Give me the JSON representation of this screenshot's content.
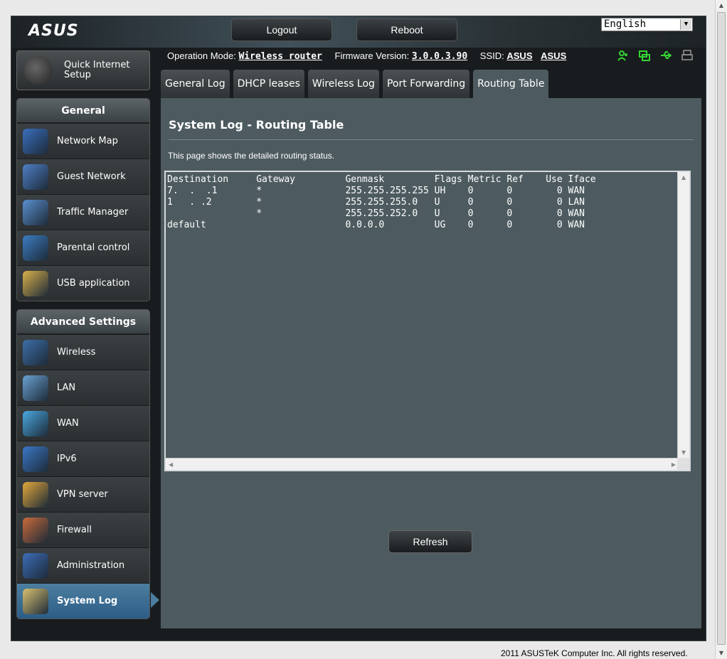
{
  "header": {
    "logo": "ASUS",
    "logout_label": "Logout",
    "reboot_label": "Reboot",
    "language": "English"
  },
  "info": {
    "op_mode_label": "Operation Mode:",
    "op_mode_value": "Wireless router",
    "fw_label": "Firmware Version:",
    "fw_value": "3.0.0.3.90",
    "ssid_label": "SSID:",
    "ssid_1": "ASUS",
    "ssid_2": "ASUS"
  },
  "status_icons": [
    "client-icon",
    "network-icon",
    "usb-icon",
    "printer-icon"
  ],
  "quick_setup": {
    "label": "Quick Internet Setup"
  },
  "general": {
    "heading": "General",
    "items": [
      {
        "label": "Network Map",
        "icon": "network-map-icon",
        "color": "#3a6fbf"
      },
      {
        "label": "Guest Network",
        "icon": "guest-network-icon",
        "color": "#4f7fc7"
      },
      {
        "label": "Traffic Manager",
        "icon": "traffic-manager-icon",
        "color": "#5a8fd0"
      },
      {
        "label": "Parental control",
        "icon": "parental-control-icon",
        "color": "#3b7cc2"
      },
      {
        "label": "USB application",
        "icon": "usb-application-icon",
        "color": "#d9b04a"
      }
    ]
  },
  "advanced": {
    "heading": "Advanced Settings",
    "items": [
      {
        "label": "Wireless",
        "icon": "wireless-icon",
        "color": "#3d6ea8"
      },
      {
        "label": "LAN",
        "icon": "lan-icon",
        "color": "#6aa1d2"
      },
      {
        "label": "WAN",
        "icon": "wan-icon",
        "color": "#4aa8e0"
      },
      {
        "label": "IPv6",
        "icon": "ipv6-icon",
        "color": "#3a78c8"
      },
      {
        "label": "VPN server",
        "icon": "vpn-server-icon",
        "color": "#e2a83a"
      },
      {
        "label": "Firewall",
        "icon": "firewall-icon",
        "color": "#c86a3a"
      },
      {
        "label": "Administration",
        "icon": "administration-icon",
        "color": "#3c6db8"
      },
      {
        "label": "System Log",
        "icon": "system-log-icon",
        "color": "#d8c070",
        "active": true
      }
    ]
  },
  "tabs": [
    {
      "label": "General Log"
    },
    {
      "label": "DHCP leases"
    },
    {
      "label": "Wireless Log"
    },
    {
      "label": "Port Forwarding"
    },
    {
      "label": "Routing Table",
      "active": true
    }
  ],
  "content": {
    "title": "System Log - Routing Table",
    "description": "This page shows the detailed routing status.",
    "log_text": "Destination     Gateway         Genmask         Flags Metric Ref    Use Iface\n7.  .  .1       *               255.255.255.255 UH    0      0        0 WAN\n1   . .2        *               255.255.255.0   U     0      0        0 LAN\n                *               255.255.252.0   U     0      0        0 WAN\ndefault                         0.0.0.0         UG    0      0        0 WAN",
    "refresh_label": "Refresh"
  },
  "footer": {
    "copyright": "2011 ASUSTeK Computer Inc. All rights reserved."
  }
}
